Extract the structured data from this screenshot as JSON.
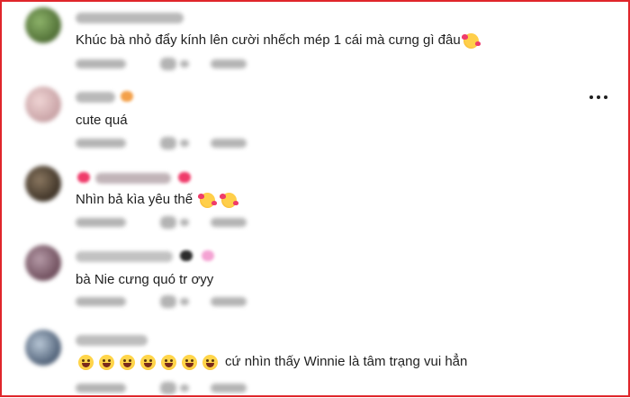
{
  "comments": [
    {
      "name": "Trần Nhu Ngọc",
      "text": "Khúc bà nhỏ đẩy kính lên cười nhếch mép 1 cái mà cưng gì đâu",
      "emoji": [
        "smiling-face-with-hearts"
      ],
      "avatar_color": "#6b8a4e"
    },
    {
      "name": "letuck",
      "text": "cute quá",
      "emoji": [],
      "avatar_color": "#d7b7b9"
    },
    {
      "name": "Love Love",
      "text": "Nhìn bả kìa yêu thế",
      "emoji": [
        "smiling-face-with-hearts",
        "smiling-face-with-hearts"
      ],
      "avatar_color": "#5b4b38"
    },
    {
      "name": "",
      "text": "bà Nie cưng quó tr ơyy",
      "emoji": [],
      "avatar_color": "#8f6a7a"
    },
    {
      "name": "Ngô Tuấn",
      "text": "cứ nhìn thấy Winnie là tâm trạng vui hẳn",
      "emoji_before": [
        "grinning-squinting-face",
        "grinning-squinting-face",
        "grinning-squinting-face",
        "grinning-squinting-face",
        "grinning-squinting-face",
        "grinning-squinting-face",
        "grinning-squinting-face"
      ],
      "avatar_color": "#7e8fa3"
    }
  ],
  "colors": {
    "frame_border": "#e0262b",
    "blurred_text": "#9a9a9a",
    "heart": "#ef3b6a"
  },
  "icons": {
    "more": "more-options-icon"
  }
}
